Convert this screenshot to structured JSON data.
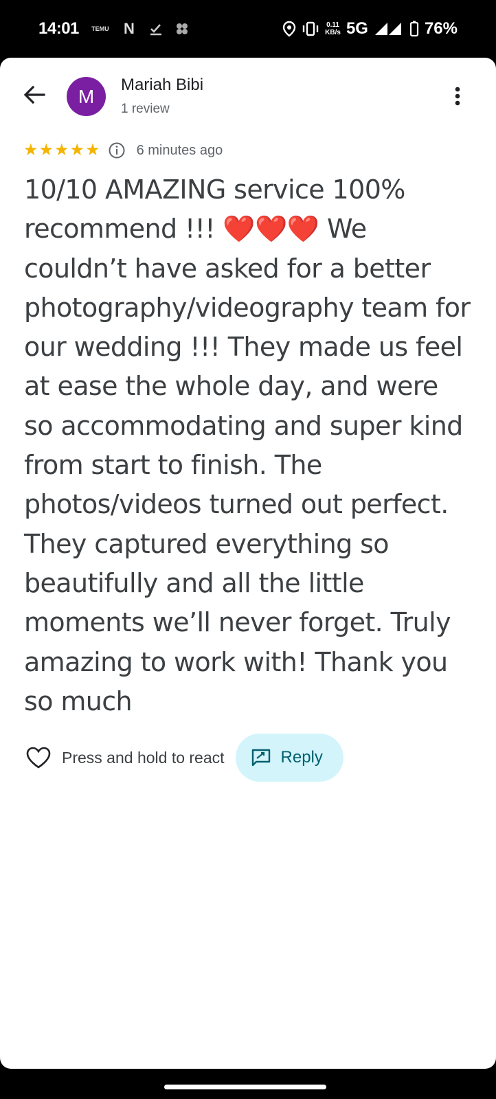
{
  "status_bar": {
    "time": "14:01",
    "notification_icons": [
      "temu-icon",
      "netflix-icon",
      "check-download-icon",
      "app-icon"
    ],
    "temu_text": "TEMU",
    "netflix_text": "N",
    "speed_value": "0.11",
    "speed_unit": "KB/s",
    "network": "5G",
    "battery": "76%"
  },
  "review": {
    "avatar_letter": "M",
    "author_name": "Mariah Bibi",
    "author_sub": "1 review",
    "rating": 5,
    "star_glyph": "★",
    "time_ago": "6 minutes ago",
    "text": "10/10 AMAZING service 100% recommend !!! ❤️❤️❤️ We couldn’t have asked for a better photography/videography team for our wedding !!! They made us feel at ease the whole day, and were so accommodating and super kind from start to finish. The photos/videos turned out perfect. They captured everything so beautifully and all the little moments we’ll never forget. Truly amazing to work with! Thank you so much"
  },
  "actions": {
    "react_label": "Press and hold to react",
    "reply_label": "Reply"
  },
  "colors": {
    "avatar": "#7b1fa2",
    "star": "#f4b400",
    "reply_bg": "#d3f4fb",
    "reply_fg": "#00606f"
  }
}
